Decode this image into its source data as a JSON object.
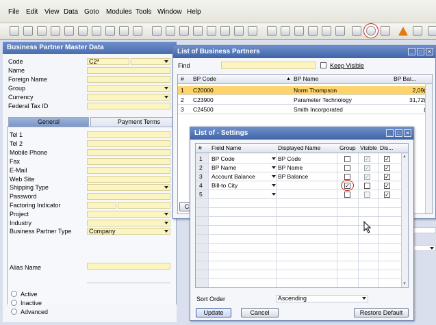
{
  "menu": [
    "File",
    "Edit",
    "View",
    "Data",
    "Goto",
    "Modules",
    "Tools",
    "Window",
    "Help"
  ],
  "bp_master": {
    "title": "Business Partner Master Data",
    "fields": [
      {
        "label": "Code",
        "value": "C2*"
      },
      {
        "label": "Name",
        "value": ""
      },
      {
        "label": "Foreign Name",
        "value": ""
      },
      {
        "label": "Group",
        "value": ""
      },
      {
        "label": "Currency",
        "value": ""
      },
      {
        "label": "Federal Tax ID",
        "value": ""
      }
    ],
    "tabs": [
      "General",
      "Payment Terms"
    ],
    "general_fields": [
      {
        "label": "Tel 1",
        "value": ""
      },
      {
        "label": "Tel 2",
        "value": ""
      },
      {
        "label": "Mobile Phone",
        "value": ""
      },
      {
        "label": "Fax",
        "value": ""
      },
      {
        "label": "E-Mail",
        "value": ""
      },
      {
        "label": "Web Site",
        "value": ""
      },
      {
        "label": "Shipping Type",
        "value": ""
      },
      {
        "label": "Password",
        "value": ""
      },
      {
        "label": "Factoring Indicator",
        "value": ""
      },
      {
        "label": "Project",
        "value": ""
      },
      {
        "label": "Industry",
        "value": ""
      },
      {
        "label": "Business Partner Type",
        "value": "Company"
      }
    ],
    "alias_label": "Alias Name",
    "status_options": [
      "Active",
      "Inactive",
      "Advanced"
    ]
  },
  "bp_list": {
    "title": "List of Business Partners",
    "find_label": "Find",
    "keep_visible_label": "Keep Visible",
    "columns": [
      "#",
      "BP Code",
      "BP Name",
      "BP Bal..."
    ],
    "rows": [
      {
        "num": "1",
        "code": "C20000",
        "name": "Norm Thompson",
        "balance": "2,09("
      },
      {
        "num": "2",
        "code": "C23900",
        "name": "Parameter Technology",
        "balance": "31,72("
      },
      {
        "num": "3",
        "code": "C24500",
        "name": "Smith Incorporated",
        "balance": "("
      }
    ],
    "cut_button": "C"
  },
  "settings": {
    "title": "List of - Settings",
    "columns": [
      "#",
      "Field Name",
      "Displayed Name",
      "Group",
      "Visible",
      "Dis..."
    ],
    "rows": [
      {
        "num": "1",
        "field": "BP Code",
        "displayed": "BP Code",
        "group": false,
        "visible": true,
        "display": true
      },
      {
        "num": "2",
        "field": "BP Name",
        "displayed": "BP Name",
        "group": false,
        "visible": true,
        "display": true
      },
      {
        "num": "3",
        "field": "Account Balance",
        "displayed": "BP Balance",
        "group": false,
        "visible": true,
        "display": true
      },
      {
        "num": "4",
        "field": "Bill-to City",
        "displayed": "",
        "group": true,
        "visible": false,
        "display": true
      },
      {
        "num": "5",
        "field": "",
        "displayed": "",
        "group": false,
        "visible": false,
        "display": true
      }
    ],
    "sort_order_label": "Sort Order",
    "sort_order_value": "Ascending",
    "buttons": {
      "update": "Update",
      "cancel": "Cancel",
      "restore": "Restore Default"
    }
  },
  "icons": [
    "new-doc-icon",
    "print-icon",
    "preview-icon",
    "mail-icon",
    "excel-icon",
    "word-icon",
    "pdf-icon",
    "lock-icon",
    "find-icon",
    "first-icon",
    "prev-icon",
    "next-icon",
    "last-icon",
    "filter-icon",
    "sort-icon",
    "form-settings-icon",
    "warning-icon",
    "calendar-icon"
  ],
  "colors": {
    "title_bar": "#3f63a8",
    "field_bg": "#fcf5c0",
    "selected_row": "#fdd36a",
    "highlight_ring": "#c81e1e"
  }
}
